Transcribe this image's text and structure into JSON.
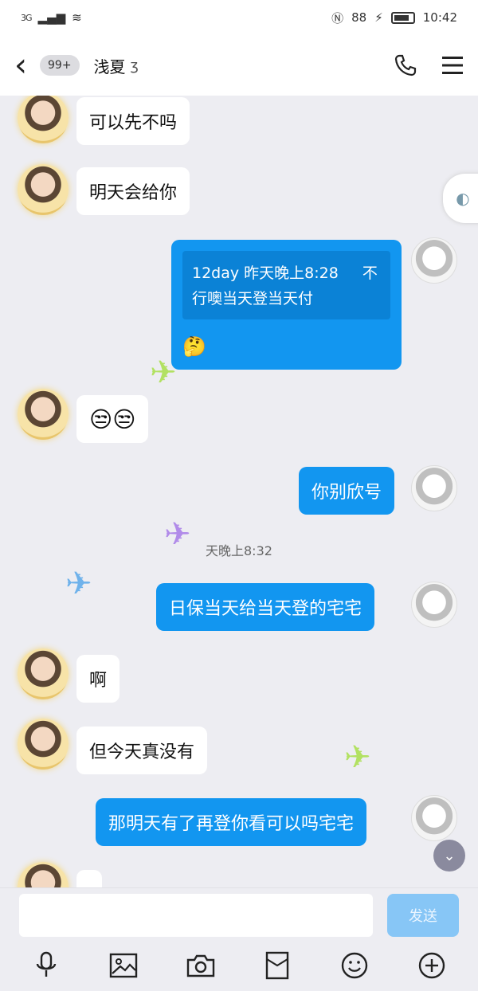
{
  "status_bar": {
    "network": "3G",
    "battery_percent": "88",
    "time": "10:42"
  },
  "header": {
    "unread_badge": "99+",
    "contact_name": "浅夏"
  },
  "messages": [
    {
      "side": "left",
      "type": "text",
      "text": "可以先不吗"
    },
    {
      "side": "left",
      "type": "text",
      "text": "明天会给你"
    },
    {
      "side": "right",
      "type": "quote",
      "quote_header": "12day 昨天晚上8:28",
      "quote_text": "不行噢当天登当天付"
    },
    {
      "side": "left",
      "type": "emoji"
    },
    {
      "side": "right",
      "type": "text",
      "text": "你别欣号"
    },
    {
      "side": "right",
      "type": "text",
      "text": "日保当天给当天登的宅宅"
    },
    {
      "side": "left",
      "type": "text",
      "text": "啊"
    },
    {
      "side": "left",
      "type": "text",
      "text": "但今天真没有"
    },
    {
      "side": "right",
      "type": "text",
      "text": "那明天有了再登你看可以吗宅宅"
    }
  ],
  "time_divider": "天晚上8:32",
  "input": {
    "placeholder": "",
    "send_label": "发送"
  },
  "colors": {
    "bubble_blue": "#1296f0",
    "send_disabled": "#87c6f6",
    "background": "#ededf2"
  },
  "icons": {
    "toolbar": [
      "microphone-icon",
      "image-icon",
      "camera-icon",
      "red-envelope-icon",
      "emoji-icon",
      "plus-icon"
    ]
  }
}
